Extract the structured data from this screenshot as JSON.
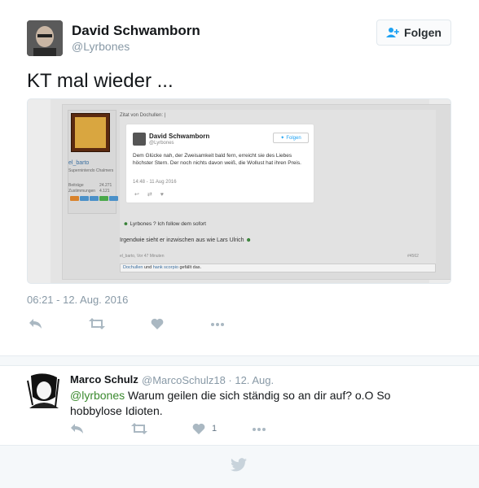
{
  "tweet": {
    "author_name": "David Schwamborn",
    "author_handle": "@Lyrbones",
    "follow_label": "Folgen",
    "text": "KT mal wieder ...",
    "timestamp": "06:21 - 12. Aug. 2016"
  },
  "embedded_screenshot": {
    "quote_header": "Zitat von Dochullen: |",
    "forum_user": "el_barto",
    "forum_user_title": "Supernintendo Chalmers",
    "stats": [
      {
        "label": "Beiträge",
        "value": "24.271"
      },
      {
        "label": "Zustimmungen",
        "value": "4.121"
      }
    ],
    "card": {
      "name": "David Schwamborn",
      "handle": "@Lyrbones",
      "follow_label": "Folgen",
      "text": "Dem Glücke nah, der Zweisamkeit bald fern, erreicht sie des Liebes höchster Stern. Der noch nichts davon weiß, die Wollust hat ihren Preis.",
      "date": "14:48 - 11 Aug 2016"
    },
    "line_follow": "Lyrbones ? Ich follow dem sofort",
    "line_comment": "Irgendwie sieht er inzwischen aus wie Lars Ulrich",
    "meta": "el_barto, Vor 47 Minuten",
    "post_id": "#4562",
    "likes_user_1": "Dochullen",
    "likes_and": "und",
    "likes_user_2": "hank scorpio",
    "likes_suffix": "gefällt das."
  },
  "reply": {
    "author_name": "Marco Schulz",
    "handle_date": "@MarcoSchulz18 · 12. Aug.",
    "mention": "@lyrbones",
    "text": " Warum geilen die sich ständig so an dir auf? o.O So hobbylose Idioten.",
    "like_count": "1"
  },
  "colors": {
    "accent_blue": "#1da1f2",
    "gray_text": "#8899a6",
    "icon_gray": "#aab8c2",
    "mention_green": "#3b8a2f"
  }
}
